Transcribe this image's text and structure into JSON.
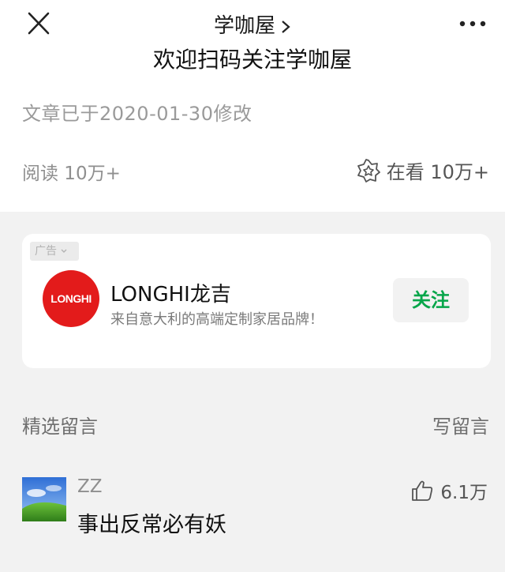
{
  "header": {
    "title": "学咖屋",
    "close_icon": "close-icon",
    "more_icon": "more-dots-icon"
  },
  "article": {
    "welcome_text": "欢迎扫码关注学咖屋",
    "modified_text": "文章已于2020-01-30修改",
    "reads_text": "阅读 10万+",
    "watching_text": "在看 10万+",
    "watching_icon": "wow-icon"
  },
  "ad": {
    "tag_label": "广告",
    "logo_text": "LONGHI",
    "name": "LONGHI龙吉",
    "description": "来自意大利的高端定制家居品牌！",
    "follow_label": "关注",
    "follow_color": "#07a64a",
    "logo_color": "#e31b1b"
  },
  "comments": {
    "section_title": "精选留言",
    "write_label": "写留言",
    "items": [
      {
        "user": "ZZ",
        "text": "事出反常必有妖",
        "likes": "6.1万",
        "like_icon": "thumbs-up-icon"
      }
    ]
  }
}
